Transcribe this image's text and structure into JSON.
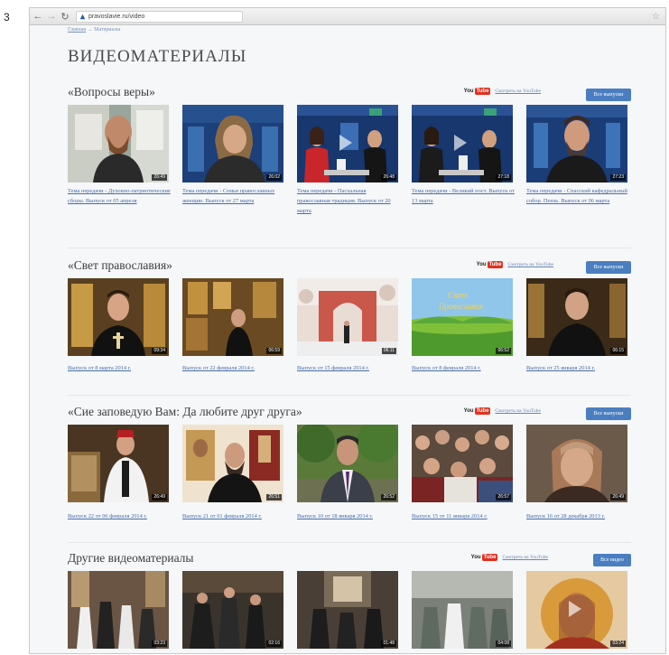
{
  "figure_number": "3",
  "browser": {
    "url": "pravoslavie.ru/video"
  },
  "breadcrumb": {
    "home": "Главная",
    "current": "Материалы"
  },
  "page_title": "ВИДЕОМАТЕРИАЛЫ",
  "sections": [
    {
      "title": "«Вопросы веры»",
      "youtube_link": "Смотреть на YouTube",
      "button": "Все выпуски",
      "items": [
        {
          "caption": "Тема передачи - Духовно-патриотические сборы. Выпуск от 05 апреля",
          "duration": "26:49"
        },
        {
          "caption": "Тема передачи - Семья православных женщин. Выпуск от 27 марта",
          "duration": "26:02"
        },
        {
          "caption": "Тема передачи - Пасхальная православная традиция. Выпуск от 20 марта",
          "duration": "26:48"
        },
        {
          "caption": "Тема передачи - Великий пост. Выпуск от 13 марта",
          "duration": "27:18"
        },
        {
          "caption": "Тема передачи - Спасский кафедральный собор. Пензь. Выпуск от 06 марта",
          "duration": "27:23"
        }
      ]
    },
    {
      "title": "«Свет православия»",
      "youtube_link": "Смотреть на YouTube",
      "button": "Все выпуски",
      "items": [
        {
          "caption": "Выпуск от 8 марта 2014 г.",
          "duration": "09:34"
        },
        {
          "caption": "Выпуск от 22 февраля 2014 г.",
          "duration": "06:59"
        },
        {
          "caption": "Выпуск от 15 февраля 2014 г.",
          "duration": "06:11"
        },
        {
          "caption": "Выпуск от 8 февраля 2014 г.",
          "duration": "06:52"
        },
        {
          "caption": "Выпуск от 25 января 2014 г.",
          "duration": "06:15"
        }
      ]
    },
    {
      "title": "«Сие заповедую Вам: Да любите друг друга»",
      "youtube_link": "Смотреть на YouTube",
      "button": "Все выпуски",
      "items": [
        {
          "caption": "Выпуск 22 от 06 февраля 2014 г.",
          "duration": "26:49"
        },
        {
          "caption": "Выпуск 21 от 01 февраля 2014 г.",
          "duration": "26:51"
        },
        {
          "caption": "Выпуск 10 от 18 января 2014 г.",
          "duration": "26:52"
        },
        {
          "caption": "Выпуск 15 от 11 января 2014 г.",
          "duration": "26:57"
        },
        {
          "caption": "Выпуск 16 от 28 декабря 2013 г.",
          "duration": "26:49"
        }
      ]
    },
    {
      "title": "Другие видеоматериалы",
      "youtube_link": "Смотреть на YouTube",
      "button": "Все видео",
      "items": [
        {
          "caption": "",
          "duration": "03:23"
        },
        {
          "caption": "",
          "duration": "02:16"
        },
        {
          "caption": "",
          "duration": "01:48"
        },
        {
          "caption": "",
          "duration": "04:08"
        },
        {
          "caption": "",
          "duration": "03:24"
        }
      ]
    }
  ]
}
